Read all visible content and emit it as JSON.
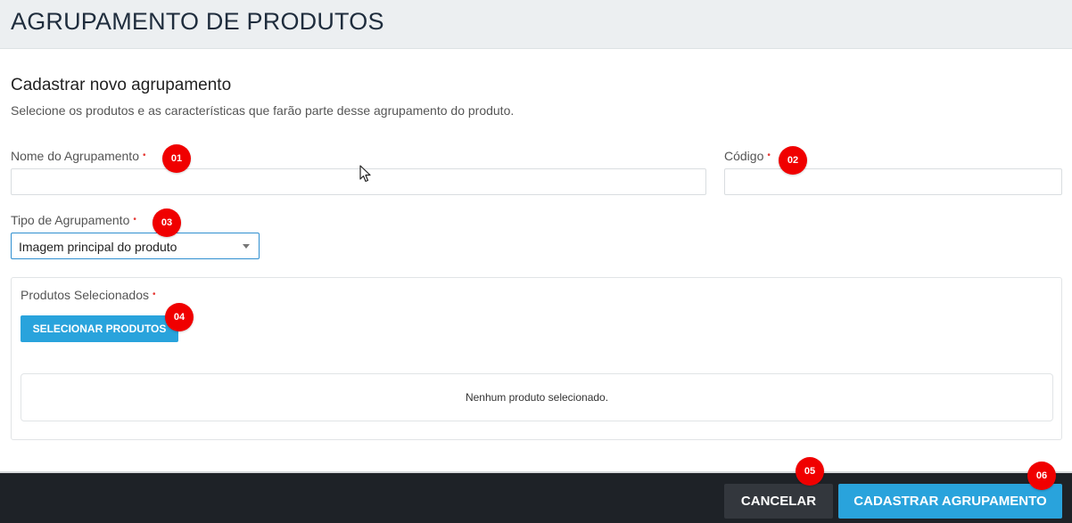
{
  "header": {
    "title": "AGRUPAMENTO DE PRODUTOS"
  },
  "section": {
    "title": "Cadastrar novo agrupamento",
    "subtitle": "Selecione os produtos e as características que farão parte desse agrupamento do produto."
  },
  "form": {
    "name_label": "Nome do Agrupamento",
    "name_value": "",
    "code_label": "Código",
    "code_value": "",
    "type_label": "Tipo de Agrupamento",
    "type_selected": "Imagem principal do produto",
    "required_mark": "•"
  },
  "products": {
    "label": "Produtos Selecionados",
    "select_button": "SELECIONAR PRODUTOS",
    "empty_message": "Nenhum produto selecionado."
  },
  "footer": {
    "cancel_label": "CANCELAR",
    "submit_label": "CADASTRAR AGRUPAMENTO"
  },
  "markers": [
    "01",
    "02",
    "03",
    "04",
    "05",
    "06"
  ],
  "colors": {
    "accent": "#29a3dc",
    "marker": "#f00000",
    "footer_bg": "#1e2227",
    "required": "#e53935"
  }
}
